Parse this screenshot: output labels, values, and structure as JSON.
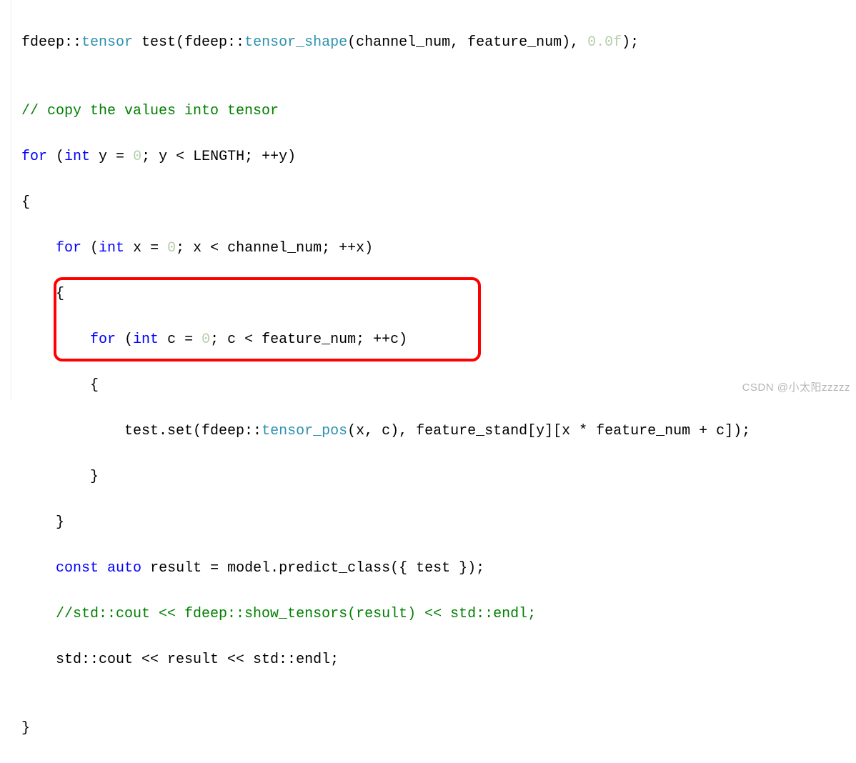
{
  "code": {
    "l1_a": "fdeep::",
    "l1_b": "tensor",
    "l1_c": " test(fdeep::",
    "l1_d": "tensor_shape",
    "l1_e": "(channel_num, feature_num), ",
    "l1_num": "0.0f",
    "l1_f": ");",
    "l2": "",
    "l3_cmt": "// copy the values into tensor",
    "l4_for": "for",
    "l4_a": " (",
    "l4_int": "int",
    "l4_b": " y = ",
    "l4_zero": "0",
    "l4_c": "; y < LENGTH; ++y)",
    "l5": "{",
    "l6_indent": "    ",
    "l6_for": "for",
    "l6_a": " (",
    "l6_int": "int",
    "l6_b": " x = ",
    "l6_zero": "0",
    "l6_c": "; x < channel_num; ++x)",
    "l7": "    {",
    "l8_indent": "        ",
    "l8_for": "for",
    "l8_a": " (",
    "l8_int": "int",
    "l8_b": " c = ",
    "l8_zero": "0",
    "l8_c": "; c < feature_num; ++c)",
    "l9": "        {",
    "l10_a": "            test.set(fdeep::",
    "l10_b": "tensor_pos",
    "l10_c": "(x, c), feature_stand[y][x * feature_num + c]);",
    "l11": "        }",
    "l12": "    }",
    "l13_indent": "    ",
    "l13_const": "const",
    "l13_sp": " ",
    "l13_auto": "auto",
    "l13_b": " result = model.predict_class({ test });",
    "l14_cmt": "    //std::cout << fdeep::show_tensors(result) << std::endl;",
    "l15": "    std::cout << result << std::endl;",
    "l16": "",
    "l17": "}"
  },
  "watermark": "CSDN @小太阳zzzzz"
}
